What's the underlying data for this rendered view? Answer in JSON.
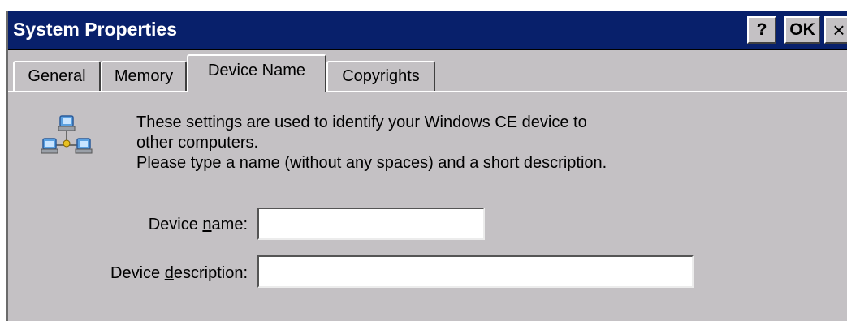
{
  "window": {
    "title": "System Properties",
    "buttons": {
      "help": "?",
      "ok": "OK",
      "close": "×"
    }
  },
  "tabs": [
    {
      "label": "General",
      "active": false
    },
    {
      "label": "Memory",
      "active": false
    },
    {
      "label": "Device Name",
      "active": true
    },
    {
      "label": "Copyrights",
      "active": false
    }
  ],
  "content": {
    "icon": "network-computers-icon",
    "info_lines": [
      "These settings are used to identify your Windows CE device to",
      "other computers.",
      "Please type a name (without any spaces) and a short description."
    ]
  },
  "fields": {
    "device_name": {
      "label_before": "Device ",
      "label_access": "n",
      "label_after": "ame:",
      "value": ""
    },
    "device_description": {
      "label_before": "Device ",
      "label_access": "d",
      "label_after": "escription:",
      "value": ""
    }
  },
  "colors": {
    "titlebar": "#08206b",
    "face": "#c4c1c4",
    "field_bg": "#ffffff"
  }
}
